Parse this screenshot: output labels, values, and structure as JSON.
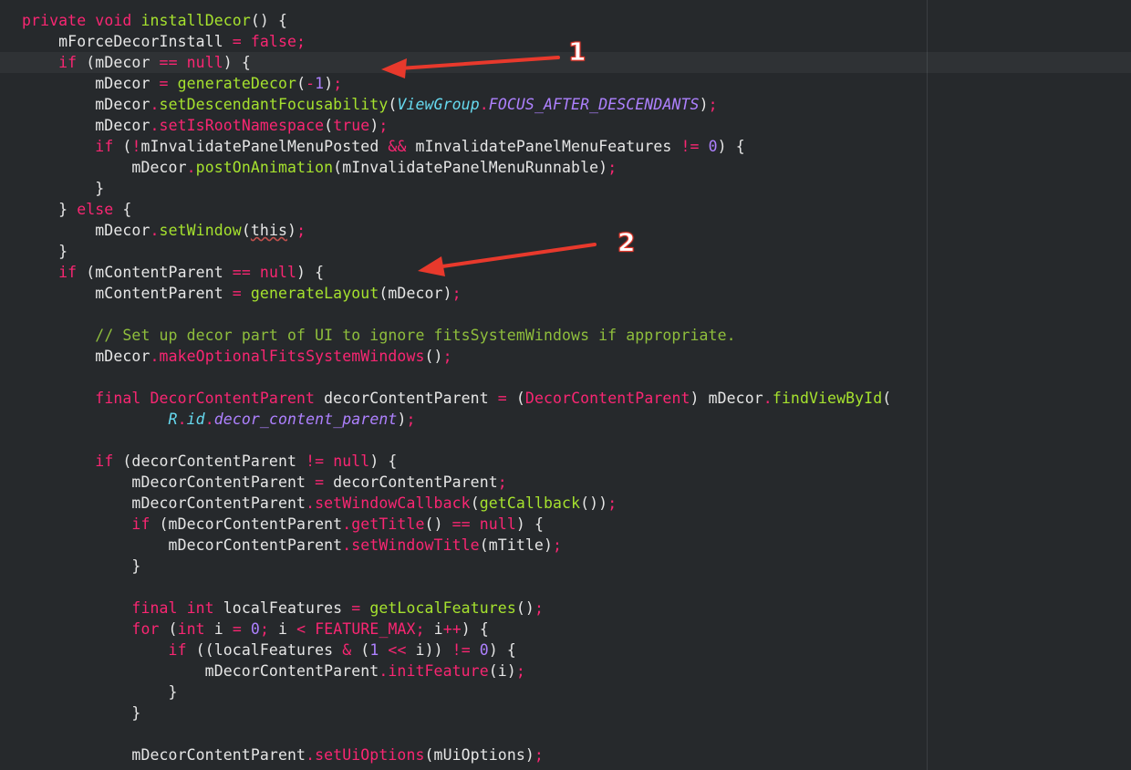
{
  "colors": {
    "background": "#26292c",
    "keyword": "#f92672",
    "function": "#a6e22e",
    "number": "#ae81ff",
    "type": "#66d9ef",
    "comment": "#8fbe3c",
    "text": "#e6e6e6",
    "annotation": "#e8392c"
  },
  "annotations": {
    "arrow1_label": "1",
    "arrow2_label": "2"
  },
  "code_lines": [
    [
      [
        "kw",
        "private "
      ],
      [
        "kw",
        "void "
      ],
      [
        "fn",
        "installDecor"
      ],
      [
        "p",
        "() {"
      ]
    ],
    [
      [
        "p",
        "    mForceDecorInstall "
      ],
      [
        "op",
        "="
      ],
      [
        "kw",
        " false"
      ],
      [
        "op",
        ";"
      ]
    ],
    [
      [
        "p",
        "    "
      ],
      [
        "kw",
        "if "
      ],
      [
        "p",
        "(mDecor "
      ],
      [
        "op",
        "=="
      ],
      [
        "kw",
        " null"
      ],
      [
        "p",
        ") {"
      ]
    ],
    [
      [
        "p",
        "        mDecor "
      ],
      [
        "op",
        "="
      ],
      [
        "p",
        " "
      ],
      [
        "fn",
        "generateDecor"
      ],
      [
        "p",
        "("
      ],
      [
        "op",
        "-"
      ],
      [
        "num",
        "1"
      ],
      [
        "p",
        ")"
      ],
      [
        "op",
        ";"
      ]
    ],
    [
      [
        "p",
        "        mDecor"
      ],
      [
        "op",
        "."
      ],
      [
        "fn",
        "setDescendantFocusability"
      ],
      [
        "p",
        "("
      ],
      [
        "type",
        "ViewGroup"
      ],
      [
        "op",
        "."
      ],
      [
        "const",
        "FOCUS_AFTER_DESCENDANTS"
      ],
      [
        "p",
        ")"
      ],
      [
        "op",
        ";"
      ]
    ],
    [
      [
        "p",
        "        mDecor"
      ],
      [
        "op",
        "."
      ],
      [
        "cls",
        "setIsRootNamespace"
      ],
      [
        "p",
        "("
      ],
      [
        "kw",
        "true"
      ],
      [
        "p",
        ")"
      ],
      [
        "op",
        ";"
      ]
    ],
    [
      [
        "p",
        "        "
      ],
      [
        "kw",
        "if "
      ],
      [
        "p",
        "("
      ],
      [
        "op",
        "!"
      ],
      [
        "p",
        "mInvalidatePanelMenuPosted "
      ],
      [
        "op",
        "&&"
      ],
      [
        "p",
        " mInvalidatePanelMenuFeatures "
      ],
      [
        "op",
        "!="
      ],
      [
        "p",
        " "
      ],
      [
        "num",
        "0"
      ],
      [
        "p",
        ") {"
      ]
    ],
    [
      [
        "p",
        "            mDecor"
      ],
      [
        "op",
        "."
      ],
      [
        "fn",
        "postOnAnimation"
      ],
      [
        "p",
        "(mInvalidatePanelMenuRunnable)"
      ],
      [
        "op",
        ";"
      ]
    ],
    [
      [
        "p",
        "        }"
      ]
    ],
    [
      [
        "p",
        "    } "
      ],
      [
        "kw",
        "else"
      ],
      [
        "p",
        " {"
      ]
    ],
    [
      [
        "p",
        "        mDecor"
      ],
      [
        "op",
        "."
      ],
      [
        "fn",
        "setWindow"
      ],
      [
        "p",
        "("
      ],
      [
        "warn",
        "this"
      ],
      [
        "p",
        ")"
      ],
      [
        "op",
        ";"
      ]
    ],
    [
      [
        "p",
        "    }"
      ]
    ],
    [
      [
        "p",
        "    "
      ],
      [
        "kw",
        "if "
      ],
      [
        "p",
        "(mContentParent "
      ],
      [
        "op",
        "=="
      ],
      [
        "kw",
        " null"
      ],
      [
        "p",
        ") {"
      ]
    ],
    [
      [
        "p",
        "        mContentParent "
      ],
      [
        "op",
        "="
      ],
      [
        "p",
        " "
      ],
      [
        "fn",
        "generateLayout"
      ],
      [
        "p",
        "(mDecor)"
      ],
      [
        "op",
        ";"
      ]
    ],
    [
      [
        "p",
        ""
      ]
    ],
    [
      [
        "p",
        "        "
      ],
      [
        "cm",
        "// Set up decor part of UI to ignore fitsSystemWindows if appropriate."
      ]
    ],
    [
      [
        "p",
        "        mDecor"
      ],
      [
        "op",
        "."
      ],
      [
        "cls",
        "makeOptionalFitsSystemWindows"
      ],
      [
        "p",
        "()"
      ],
      [
        "op",
        ";"
      ]
    ],
    [
      [
        "p",
        ""
      ]
    ],
    [
      [
        "p",
        "        "
      ],
      [
        "kw",
        "final "
      ],
      [
        "cls",
        "DecorContentParent"
      ],
      [
        "p",
        " decorContentParent "
      ],
      [
        "op",
        "="
      ],
      [
        "p",
        " ("
      ],
      [
        "cls",
        "DecorContentParent"
      ],
      [
        "p",
        ") mDecor"
      ],
      [
        "op",
        "."
      ],
      [
        "fn",
        "findViewById"
      ],
      [
        "p",
        "("
      ]
    ],
    [
      [
        "p",
        "                "
      ],
      [
        "type",
        "R"
      ],
      [
        "op",
        "."
      ],
      [
        "type",
        "id"
      ],
      [
        "op",
        "."
      ],
      [
        "const",
        "decor_content_parent"
      ],
      [
        "p",
        ")"
      ],
      [
        "op",
        ";"
      ]
    ],
    [
      [
        "p",
        ""
      ]
    ],
    [
      [
        "p",
        "        "
      ],
      [
        "kw",
        "if "
      ],
      [
        "p",
        "(decorContentParent "
      ],
      [
        "op",
        "!="
      ],
      [
        "kw",
        " null"
      ],
      [
        "p",
        ") {"
      ]
    ],
    [
      [
        "p",
        "            mDecorContentParent "
      ],
      [
        "op",
        "="
      ],
      [
        "p",
        " decorContentParent"
      ],
      [
        "op",
        ";"
      ]
    ],
    [
      [
        "p",
        "            mDecorContentParent"
      ],
      [
        "op",
        "."
      ],
      [
        "cls",
        "setWindowCallback"
      ],
      [
        "p",
        "("
      ],
      [
        "fn",
        "getCallback"
      ],
      [
        "p",
        "())"
      ],
      [
        "op",
        ";"
      ]
    ],
    [
      [
        "p",
        "            "
      ],
      [
        "kw",
        "if "
      ],
      [
        "p",
        "(mDecorContentParent"
      ],
      [
        "op",
        "."
      ],
      [
        "cls",
        "getTitle"
      ],
      [
        "p",
        "() "
      ],
      [
        "op",
        "=="
      ],
      [
        "kw",
        " null"
      ],
      [
        "p",
        ") {"
      ]
    ],
    [
      [
        "p",
        "                mDecorContentParent"
      ],
      [
        "op",
        "."
      ],
      [
        "cls",
        "setWindowTitle"
      ],
      [
        "p",
        "(mTitle)"
      ],
      [
        "op",
        ";"
      ]
    ],
    [
      [
        "p",
        "            }"
      ]
    ],
    [
      [
        "p",
        ""
      ]
    ],
    [
      [
        "p",
        "            "
      ],
      [
        "kw",
        "final "
      ],
      [
        "kw",
        "int"
      ],
      [
        "p",
        " localFeatures "
      ],
      [
        "op",
        "="
      ],
      [
        "p",
        " "
      ],
      [
        "fn",
        "getLocalFeatures"
      ],
      [
        "p",
        "()"
      ],
      [
        "op",
        ";"
      ]
    ],
    [
      [
        "p",
        "            "
      ],
      [
        "kw",
        "for "
      ],
      [
        "p",
        "("
      ],
      [
        "kw",
        "int"
      ],
      [
        "p",
        " i "
      ],
      [
        "op",
        "="
      ],
      [
        "p",
        " "
      ],
      [
        "num",
        "0"
      ],
      [
        "op",
        ";"
      ],
      [
        "p",
        " i "
      ],
      [
        "op",
        "<"
      ],
      [
        "p",
        " "
      ],
      [
        "cls",
        "FEATURE_MAX"
      ],
      [
        "op",
        ";"
      ],
      [
        "p",
        " i"
      ],
      [
        "op",
        "++"
      ],
      [
        "p",
        ") {"
      ]
    ],
    [
      [
        "p",
        "                "
      ],
      [
        "kw",
        "if "
      ],
      [
        "p",
        "((localFeatures "
      ],
      [
        "op",
        "&"
      ],
      [
        "p",
        " ("
      ],
      [
        "num",
        "1"
      ],
      [
        "p",
        " "
      ],
      [
        "op",
        "<<"
      ],
      [
        "p",
        " i)) "
      ],
      [
        "op",
        "!="
      ],
      [
        "p",
        " "
      ],
      [
        "num",
        "0"
      ],
      [
        "p",
        ") {"
      ]
    ],
    [
      [
        "p",
        "                    mDecorContentParent"
      ],
      [
        "op",
        "."
      ],
      [
        "cls",
        "initFeature"
      ],
      [
        "p",
        "(i)"
      ],
      [
        "op",
        ";"
      ]
    ],
    [
      [
        "p",
        "                }"
      ]
    ],
    [
      [
        "p",
        "            }"
      ]
    ],
    [
      [
        "p",
        ""
      ]
    ],
    [
      [
        "p",
        "            mDecorContentParent"
      ],
      [
        "op",
        "."
      ],
      [
        "cls",
        "setUiOptions"
      ],
      [
        "p",
        "(mUiOptions)"
      ],
      [
        "op",
        ";"
      ]
    ]
  ]
}
